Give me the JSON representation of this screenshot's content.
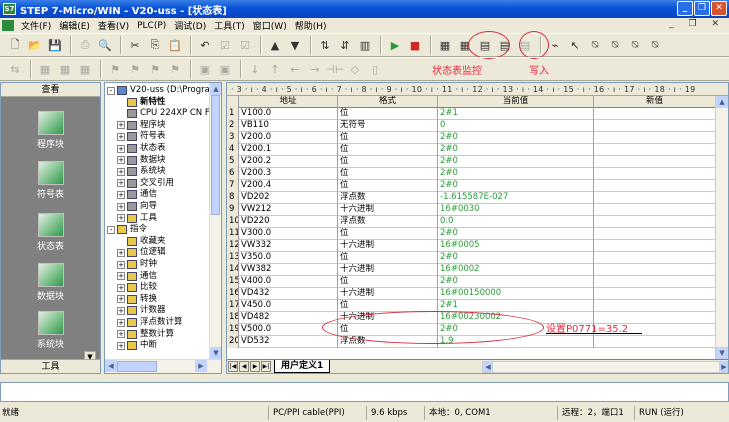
{
  "window": {
    "title": "STEP 7-Micro/WIN - V20-uss - [状态表]"
  },
  "menu": [
    "文件(F)",
    "编辑(E)",
    "查看(V)",
    "PLC(P)",
    "调试(D)",
    "工具(T)",
    "窗口(W)",
    "帮助(H)"
  ],
  "annotations": {
    "monitor_label": "状态表监控",
    "write_label": "写入",
    "set_note": "设置P0771=35.2"
  },
  "nav": {
    "header": "查看",
    "footer": "工具",
    "items": [
      "程序块",
      "符号表",
      "状态表",
      "数据块",
      "系统块"
    ]
  },
  "tree": [
    {
      "label": "V20-uss (D:\\Program",
      "level": 0,
      "pm": "-",
      "icon": "b"
    },
    {
      "label": "新特性",
      "level": 1,
      "pm": "",
      "icon": "y",
      "bold": true
    },
    {
      "label": "CPU 224XP CN F",
      "level": 1,
      "pm": "",
      "icon": "g"
    },
    {
      "label": "程序块",
      "level": 1,
      "pm": "+",
      "icon": "g"
    },
    {
      "label": "符号表",
      "level": 1,
      "pm": "+",
      "icon": "g"
    },
    {
      "label": "状态表",
      "level": 1,
      "pm": "+",
      "icon": "g"
    },
    {
      "label": "数据块",
      "level": 1,
      "pm": "+",
      "icon": "g"
    },
    {
      "label": "系统块",
      "level": 1,
      "pm": "+",
      "icon": "g"
    },
    {
      "label": "交叉引用",
      "level": 1,
      "pm": "+",
      "icon": "g"
    },
    {
      "label": "通信",
      "level": 1,
      "pm": "+",
      "icon": "g"
    },
    {
      "label": "向导",
      "level": 1,
      "pm": "+",
      "icon": "g"
    },
    {
      "label": "工具",
      "level": 1,
      "pm": "+",
      "icon": "y"
    },
    {
      "label": "指令",
      "level": 0,
      "pm": "-",
      "icon": "y"
    },
    {
      "label": "收藏夹",
      "level": 1,
      "pm": "",
      "icon": "y"
    },
    {
      "label": "位逻辑",
      "level": 1,
      "pm": "+",
      "icon": "y"
    },
    {
      "label": "时钟",
      "level": 1,
      "pm": "+",
      "icon": "y"
    },
    {
      "label": "通信",
      "level": 1,
      "pm": "+",
      "icon": "y"
    },
    {
      "label": "比较",
      "level": 1,
      "pm": "+",
      "icon": "y"
    },
    {
      "label": "转换",
      "level": 1,
      "pm": "+",
      "icon": "y"
    },
    {
      "label": "计数器",
      "level": 1,
      "pm": "+",
      "icon": "y"
    },
    {
      "label": "浮点数计算",
      "level": 1,
      "pm": "+",
      "icon": "y"
    },
    {
      "label": "整数计算",
      "level": 1,
      "pm": "+",
      "icon": "y"
    },
    {
      "label": "中断",
      "level": 1,
      "pm": "+",
      "icon": "y"
    }
  ],
  "ruler": "· 3 · ı · 4 · ı · 5 · ı · 6 · ı · 7 · ı · 8 · ı · 9 · ı · 10 · ı · 11 · ı · 12 · ı · 13 · ı · 14 · ı · 15 · ı · 16 · ı · 17 · ı · 18 · ı · 19",
  "table": {
    "headers": [
      "",
      "地址",
      "格式",
      "当前值",
      "新值"
    ],
    "rows": [
      [
        "1",
        "V100.0",
        "位",
        "2#1",
        ""
      ],
      [
        "2",
        "VB110",
        "无符号",
        "0",
        ""
      ],
      [
        "3",
        "V200.0",
        "位",
        "2#0",
        ""
      ],
      [
        "4",
        "V200.1",
        "位",
        "2#0",
        ""
      ],
      [
        "5",
        "V200.2",
        "位",
        "2#0",
        ""
      ],
      [
        "6",
        "V200.3",
        "位",
        "2#0",
        ""
      ],
      [
        "7",
        "V200.4",
        "位",
        "2#0",
        ""
      ],
      [
        "8",
        "VD202",
        "浮点数",
        "-1.615587E-027",
        ""
      ],
      [
        "9",
        "VW212",
        "十六进制",
        "16#0030",
        ""
      ],
      [
        "10",
        "VD220",
        "浮点数",
        "0.0",
        ""
      ],
      [
        "11",
        "V300.0",
        "位",
        "2#0",
        ""
      ],
      [
        "12",
        "VW332",
        "十六进制",
        "16#0005",
        ""
      ],
      [
        "13",
        "V350.0",
        "位",
        "2#0",
        ""
      ],
      [
        "14",
        "VW382",
        "十六进制",
        "16#0002",
        ""
      ],
      [
        "15",
        "V400.0",
        "位",
        "2#0",
        ""
      ],
      [
        "16",
        "VD432",
        "十六进制",
        "16#00150000",
        ""
      ],
      [
        "17",
        "V450.0",
        "位",
        "2#1",
        ""
      ],
      [
        "18",
        "VD482",
        "十六进制",
        "16#00230002",
        ""
      ],
      [
        "19",
        "V500.0",
        "位",
        "2#0",
        ""
      ],
      [
        "20",
        "VD532",
        "浮点数",
        "1.9",
        ""
      ]
    ]
  },
  "sheet_tab": "用户定义1",
  "status": {
    "ready": "就绪",
    "cable": "PC/PPI cable(PPI)",
    "baud": "9.6 kbps",
    "local": "本地：0, COM1",
    "remote": "远程：2，端口1",
    "mode": "RUN (运行)"
  },
  "colors": {
    "title_bar": "#0a52d8",
    "current_value": "#2a9d3a",
    "annotation_red": "#e8283c"
  }
}
